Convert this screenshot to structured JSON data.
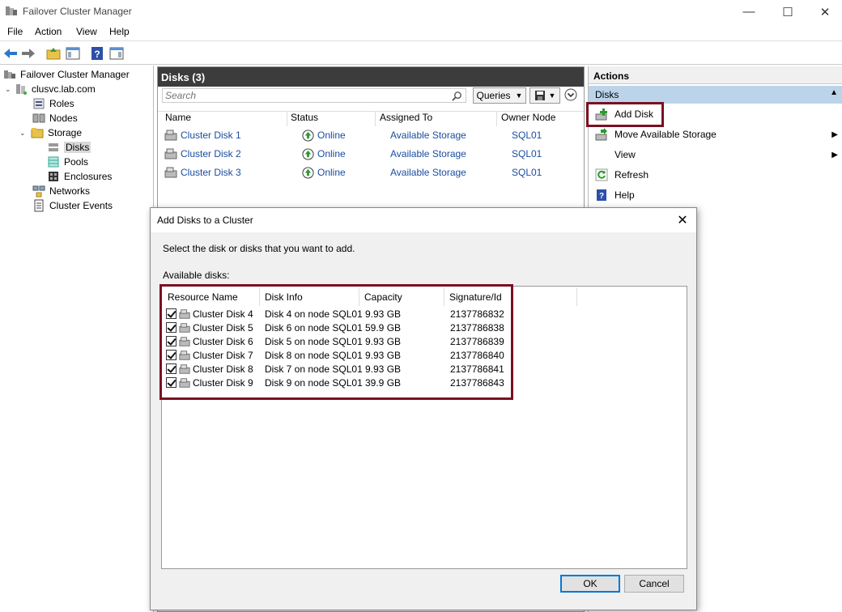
{
  "window": {
    "title": "Failover Cluster Manager",
    "controls": [
      "—",
      "☐",
      "✕"
    ]
  },
  "menu": [
    "File",
    "Action",
    "View",
    "Help"
  ],
  "tree": {
    "root": "Failover Cluster Manager",
    "cluster": "clusvc.lab.com",
    "roles": "Roles",
    "nodes": "Nodes",
    "storage": "Storage",
    "disks": "Disks",
    "pools": "Pools",
    "enclosures": "Enclosures",
    "networks": "Networks",
    "events": "Cluster Events"
  },
  "center": {
    "title": "Disks (3)",
    "search_placeholder": "Search",
    "queries": "Queries",
    "columns": [
      "Name",
      "Status",
      "Assigned To",
      "Owner Node"
    ],
    "rows": [
      {
        "name": "Cluster Disk 1",
        "status": "Online",
        "assigned": "Available Storage",
        "owner": "SQL01"
      },
      {
        "name": "Cluster Disk 2",
        "status": "Online",
        "assigned": "Available Storage",
        "owner": "SQL01"
      },
      {
        "name": "Cluster Disk 3",
        "status": "Online",
        "assigned": "Available Storage",
        "owner": "SQL01"
      }
    ]
  },
  "actions": {
    "header": "Actions",
    "section": "Disks",
    "items": [
      "Add Disk",
      "Move Available Storage",
      "View",
      "Refresh",
      "Help"
    ]
  },
  "dialog": {
    "title": "Add Disks to a Cluster",
    "instruction": "Select the disk or disks that you want to add.",
    "available_label": "Available disks:",
    "columns": [
      "Resource Name",
      "Disk Info",
      "Capacity",
      "Signature/Id"
    ],
    "rows": [
      {
        "name": "Cluster Disk 4",
        "info": "Disk 4 on node SQL01",
        "capacity": "9.93 GB",
        "sig": "2137786832"
      },
      {
        "name": "Cluster Disk 5",
        "info": "Disk 6 on node SQL01",
        "capacity": "59.9 GB",
        "sig": "2137786838"
      },
      {
        "name": "Cluster Disk 6",
        "info": "Disk 5 on node SQL01",
        "capacity": "9.93 GB",
        "sig": "2137786839"
      },
      {
        "name": "Cluster Disk 7",
        "info": "Disk 8 on node SQL01",
        "capacity": "9.93 GB",
        "sig": "2137786840"
      },
      {
        "name": "Cluster Disk 8",
        "info": "Disk 7 on node SQL01",
        "capacity": "9.93 GB",
        "sig": "2137786841"
      },
      {
        "name": "Cluster Disk 9",
        "info": "Disk 9 on node SQL01",
        "capacity": "39.9 GB",
        "sig": "2137786843"
      }
    ],
    "ok": "OK",
    "cancel": "Cancel"
  },
  "colors": {
    "highlight": "#7a1022",
    "header_dark": "#3c3c3c",
    "action_section": "#bcd4ea",
    "link": "#1a4da0"
  }
}
